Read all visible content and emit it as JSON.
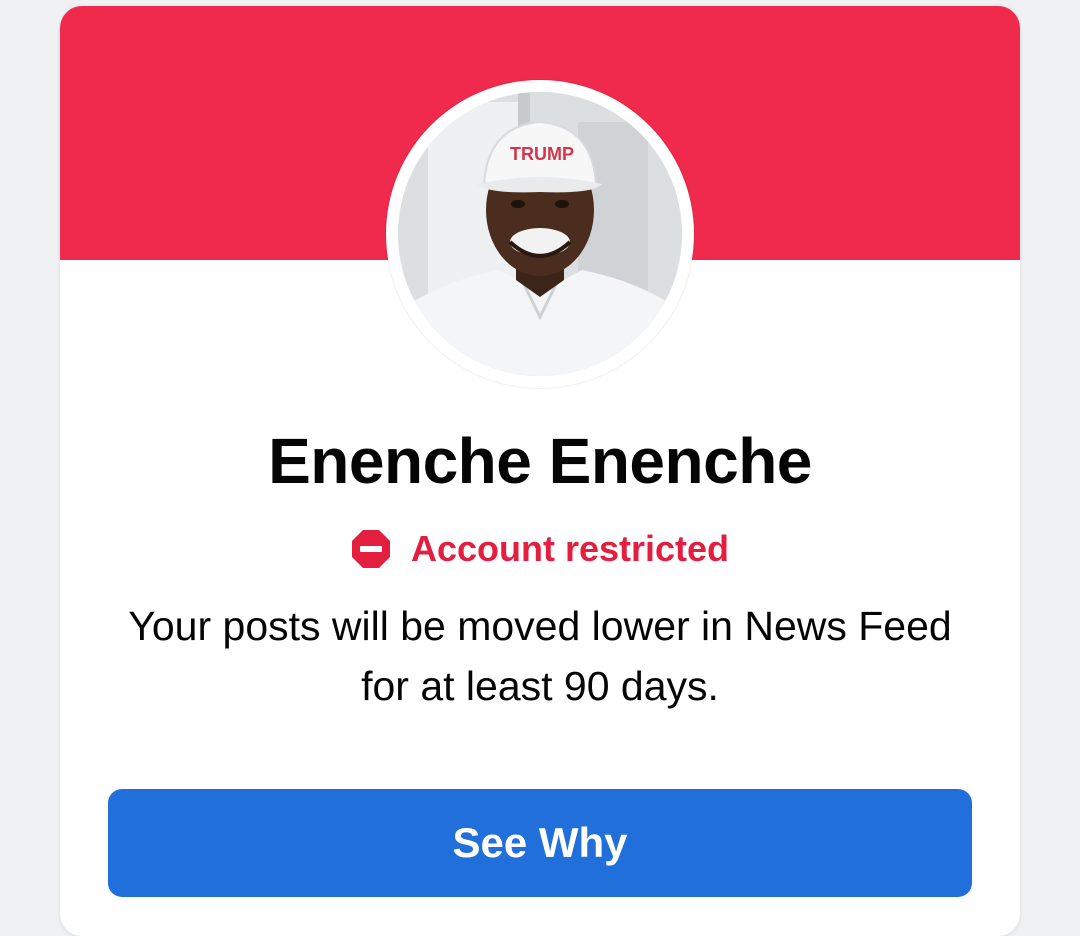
{
  "profile": {
    "name": "Enenche Enenche",
    "avatar_alt": "profile-photo",
    "hat_text": "TRUMP"
  },
  "status": {
    "label": "Account restricted",
    "icon": "restricted-icon"
  },
  "message": {
    "text": "Your posts will be moved lower in News Feed for at least 90 days."
  },
  "actions": {
    "see_why_label": "See Why"
  },
  "colors": {
    "banner": "#ef2a4c",
    "status": "#e41e3f",
    "button": "#216fdb"
  }
}
